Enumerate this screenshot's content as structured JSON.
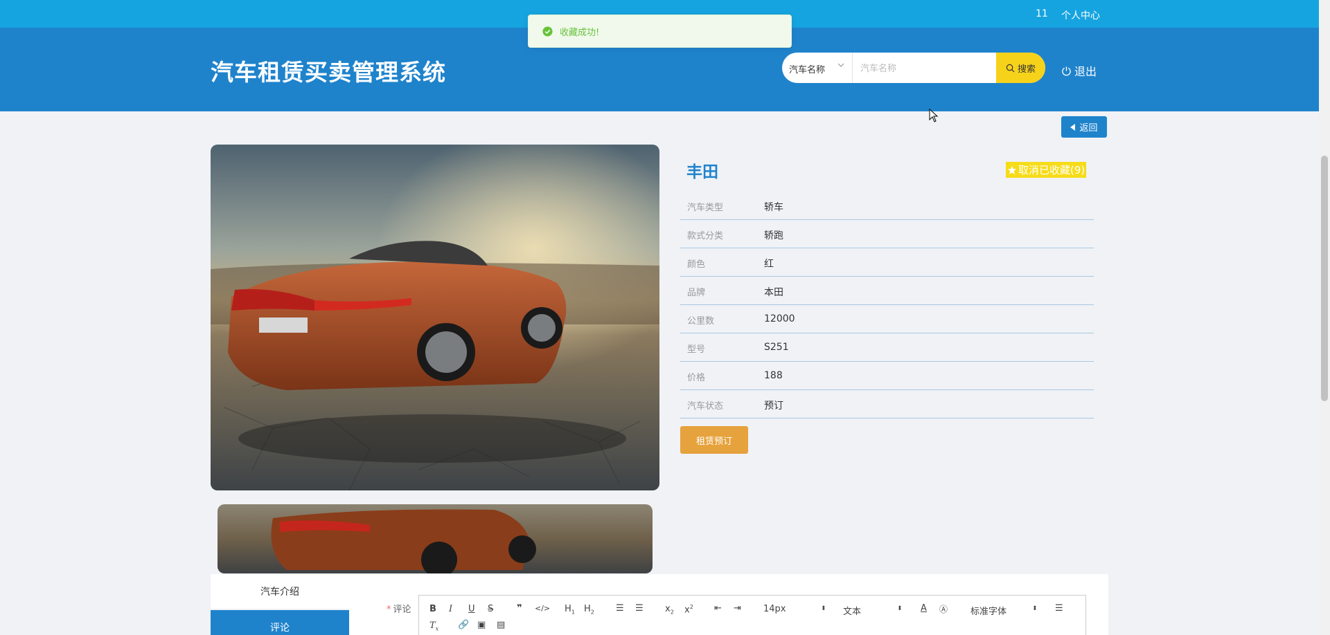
{
  "topbar": {
    "user": "11",
    "center": "个人中心"
  },
  "header": {
    "title": "汽车租赁买卖管理系统",
    "search_select": "汽车名称",
    "search_placeholder": "汽车名称",
    "search_button": "搜索",
    "logout": "退出"
  },
  "toast": {
    "text": "收藏成功!"
  },
  "back_button": "返回",
  "car": {
    "name": "丰田",
    "favorite": "取消已收藏(9)",
    "fields": [
      {
        "label": "汽车类型",
        "value": "轿车"
      },
      {
        "label": "款式分类",
        "value": "轿跑"
      },
      {
        "label": "颜色",
        "value": "红"
      },
      {
        "label": "品牌",
        "value": "本田"
      },
      {
        "label": "公里数",
        "value": "12000"
      },
      {
        "label": "型号",
        "value": "S251"
      },
      {
        "label": "价格",
        "value": "188"
      },
      {
        "label": "汽车状态",
        "value": "预订"
      }
    ],
    "rent_button": "租赁预订"
  },
  "tabs": [
    "汽车介绍",
    "评论"
  ],
  "comment": {
    "label": "评论",
    "toolbar": {
      "font_size": "14px",
      "block_type": "文本",
      "font_family": "标准字体"
    }
  },
  "colors": {
    "topstrip": "#16a4e0",
    "header": "#1f83cc",
    "search_button": "#f7d21b",
    "rent_button": "#e6a23c",
    "favorite": "#f6dc19"
  }
}
